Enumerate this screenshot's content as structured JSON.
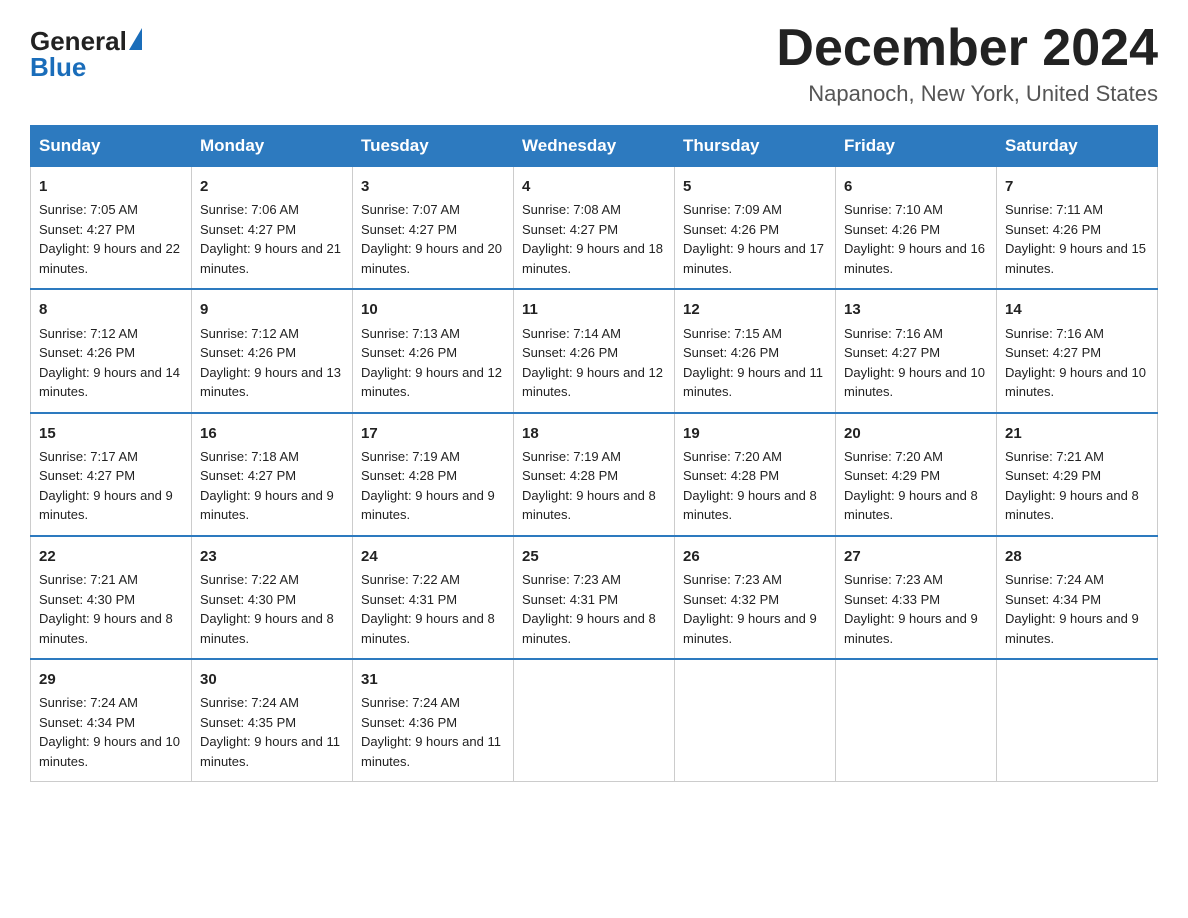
{
  "logo": {
    "general": "General",
    "blue": "Blue"
  },
  "header": {
    "month_year": "December 2024",
    "location": "Napanoch, New York, United States"
  },
  "days_of_week": [
    "Sunday",
    "Monday",
    "Tuesday",
    "Wednesday",
    "Thursday",
    "Friday",
    "Saturday"
  ],
  "weeks": [
    [
      {
        "day": "1",
        "sunrise": "7:05 AM",
        "sunset": "4:27 PM",
        "daylight": "9 hours and 22 minutes."
      },
      {
        "day": "2",
        "sunrise": "7:06 AM",
        "sunset": "4:27 PM",
        "daylight": "9 hours and 21 minutes."
      },
      {
        "day": "3",
        "sunrise": "7:07 AM",
        "sunset": "4:27 PM",
        "daylight": "9 hours and 20 minutes."
      },
      {
        "day": "4",
        "sunrise": "7:08 AM",
        "sunset": "4:27 PM",
        "daylight": "9 hours and 18 minutes."
      },
      {
        "day": "5",
        "sunrise": "7:09 AM",
        "sunset": "4:26 PM",
        "daylight": "9 hours and 17 minutes."
      },
      {
        "day": "6",
        "sunrise": "7:10 AM",
        "sunset": "4:26 PM",
        "daylight": "9 hours and 16 minutes."
      },
      {
        "day": "7",
        "sunrise": "7:11 AM",
        "sunset": "4:26 PM",
        "daylight": "9 hours and 15 minutes."
      }
    ],
    [
      {
        "day": "8",
        "sunrise": "7:12 AM",
        "sunset": "4:26 PM",
        "daylight": "9 hours and 14 minutes."
      },
      {
        "day": "9",
        "sunrise": "7:12 AM",
        "sunset": "4:26 PM",
        "daylight": "9 hours and 13 minutes."
      },
      {
        "day": "10",
        "sunrise": "7:13 AM",
        "sunset": "4:26 PM",
        "daylight": "9 hours and 12 minutes."
      },
      {
        "day": "11",
        "sunrise": "7:14 AM",
        "sunset": "4:26 PM",
        "daylight": "9 hours and 12 minutes."
      },
      {
        "day": "12",
        "sunrise": "7:15 AM",
        "sunset": "4:26 PM",
        "daylight": "9 hours and 11 minutes."
      },
      {
        "day": "13",
        "sunrise": "7:16 AM",
        "sunset": "4:27 PM",
        "daylight": "9 hours and 10 minutes."
      },
      {
        "day": "14",
        "sunrise": "7:16 AM",
        "sunset": "4:27 PM",
        "daylight": "9 hours and 10 minutes."
      }
    ],
    [
      {
        "day": "15",
        "sunrise": "7:17 AM",
        "sunset": "4:27 PM",
        "daylight": "9 hours and 9 minutes."
      },
      {
        "day": "16",
        "sunrise": "7:18 AM",
        "sunset": "4:27 PM",
        "daylight": "9 hours and 9 minutes."
      },
      {
        "day": "17",
        "sunrise": "7:19 AM",
        "sunset": "4:28 PM",
        "daylight": "9 hours and 9 minutes."
      },
      {
        "day": "18",
        "sunrise": "7:19 AM",
        "sunset": "4:28 PM",
        "daylight": "9 hours and 8 minutes."
      },
      {
        "day": "19",
        "sunrise": "7:20 AM",
        "sunset": "4:28 PM",
        "daylight": "9 hours and 8 minutes."
      },
      {
        "day": "20",
        "sunrise": "7:20 AM",
        "sunset": "4:29 PM",
        "daylight": "9 hours and 8 minutes."
      },
      {
        "day": "21",
        "sunrise": "7:21 AM",
        "sunset": "4:29 PM",
        "daylight": "9 hours and 8 minutes."
      }
    ],
    [
      {
        "day": "22",
        "sunrise": "7:21 AM",
        "sunset": "4:30 PM",
        "daylight": "9 hours and 8 minutes."
      },
      {
        "day": "23",
        "sunrise": "7:22 AM",
        "sunset": "4:30 PM",
        "daylight": "9 hours and 8 minutes."
      },
      {
        "day": "24",
        "sunrise": "7:22 AM",
        "sunset": "4:31 PM",
        "daylight": "9 hours and 8 minutes."
      },
      {
        "day": "25",
        "sunrise": "7:23 AM",
        "sunset": "4:31 PM",
        "daylight": "9 hours and 8 minutes."
      },
      {
        "day": "26",
        "sunrise": "7:23 AM",
        "sunset": "4:32 PM",
        "daylight": "9 hours and 9 minutes."
      },
      {
        "day": "27",
        "sunrise": "7:23 AM",
        "sunset": "4:33 PM",
        "daylight": "9 hours and 9 minutes."
      },
      {
        "day": "28",
        "sunrise": "7:24 AM",
        "sunset": "4:34 PM",
        "daylight": "9 hours and 9 minutes."
      }
    ],
    [
      {
        "day": "29",
        "sunrise": "7:24 AM",
        "sunset": "4:34 PM",
        "daylight": "9 hours and 10 minutes."
      },
      {
        "day": "30",
        "sunrise": "7:24 AM",
        "sunset": "4:35 PM",
        "daylight": "9 hours and 11 minutes."
      },
      {
        "day": "31",
        "sunrise": "7:24 AM",
        "sunset": "4:36 PM",
        "daylight": "9 hours and 11 minutes."
      },
      null,
      null,
      null,
      null
    ]
  ]
}
